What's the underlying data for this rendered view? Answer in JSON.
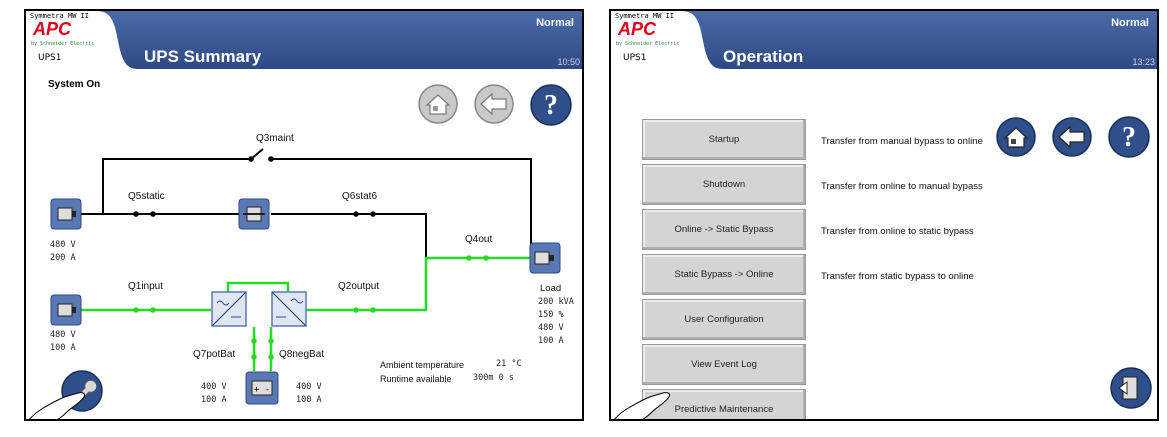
{
  "left_screen": {
    "header": {
      "product": "Symmetra MW II",
      "logo": "APC",
      "brand": "by Schneider Electric",
      "device": "UPS1",
      "title": "UPS Summary",
      "status": "Normal",
      "time": "10:50"
    },
    "system_state": "System On",
    "nav_icons": [
      "home-icon",
      "back-arrow-icon",
      "help-icon"
    ],
    "switch_labels": {
      "q3": "Q3maint",
      "q5": "Q5static",
      "q6": "Q6stat6",
      "q4": "Q4out",
      "q1": "Q1input",
      "q2": "Q2output",
      "q7": "Q7potBat",
      "q8": "Q8negBat"
    },
    "bypass_input": {
      "voltage": "480 V",
      "current": "200 A"
    },
    "main_input": {
      "voltage": "480 V",
      "current": "100 A"
    },
    "load": {
      "label": "Load",
      "power": "200 kVA",
      "percent": "150 %",
      "voltage": "480 V",
      "current": "100 A"
    },
    "battery_left": {
      "voltage": "400 V",
      "current": "100 A"
    },
    "battery_right": {
      "voltage": "400 V",
      "current": "100 A"
    },
    "ambient_label": "Ambient temperature",
    "ambient_value": "21 °C",
    "runtime_label": "Runtime available",
    "runtime_value": "300m 0 s",
    "tool_icon": "wrench-icon",
    "colors": {
      "active_line": "#22dd22",
      "inactive_line": "#000000",
      "header": "#3a5a98"
    }
  },
  "right_screen": {
    "header": {
      "product": "Symmetra MW II",
      "logo": "APC",
      "brand": "by Schneider Electric",
      "device": "UPS1",
      "title": "Operation",
      "status": "Normal",
      "time": "13:23"
    },
    "buttons": [
      {
        "label": "Startup",
        "desc": "Transfer from manual bypass to online"
      },
      {
        "label": "Shutdown",
        "desc": "Transfer from online to manual bypass"
      },
      {
        "label": "Online -> Static Bypass",
        "desc": "Transfer from online to static bypass"
      },
      {
        "label": "Static Bypass -> Online",
        "desc": "Transfer from static bypass to online"
      },
      {
        "label": "User Configuration",
        "desc": ""
      },
      {
        "label": "View Event Log",
        "desc": ""
      },
      {
        "label": "Predictive Maintenance",
        "desc": ""
      }
    ],
    "nav_icons": [
      "home-icon",
      "back-arrow-icon",
      "help-icon"
    ],
    "exit_icon": "exit-door-icon"
  }
}
